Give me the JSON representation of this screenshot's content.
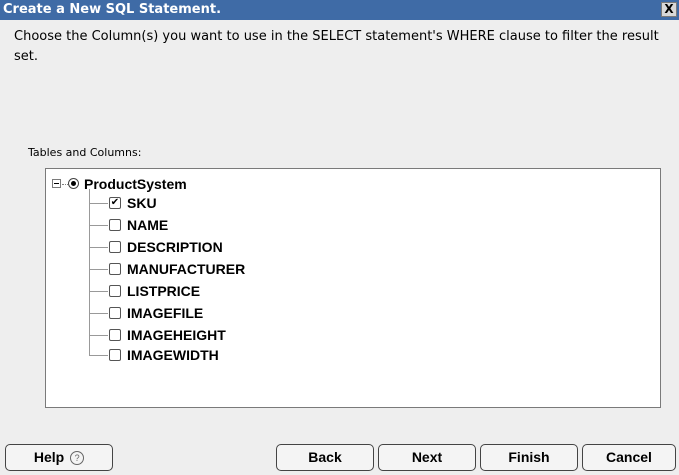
{
  "window": {
    "title": "Create a New SQL Statement.",
    "close_glyph": "X"
  },
  "instruction": "Choose the Column(s) you want to use in the SELECT statement's WHERE clause to filter the result set.",
  "tree": {
    "section_label": "Tables and Columns:",
    "root": {
      "label": "ProductSystem",
      "selected": true,
      "expanded": true
    },
    "columns": [
      {
        "label": "SKU",
        "checked": true,
        "check_glyph": "✔"
      },
      {
        "label": "NAME",
        "checked": false,
        "check_glyph": ""
      },
      {
        "label": "DESCRIPTION",
        "checked": false,
        "check_glyph": ""
      },
      {
        "label": "MANUFACTURER",
        "checked": false,
        "check_glyph": ""
      },
      {
        "label": "LISTPRICE",
        "checked": false,
        "check_glyph": ""
      },
      {
        "label": "IMAGEFILE",
        "checked": false,
        "check_glyph": ""
      },
      {
        "label": "IMAGEHEIGHT",
        "checked": false,
        "check_glyph": ""
      },
      {
        "label": "IMAGEWIDTH",
        "checked": false,
        "check_glyph": ""
      }
    ]
  },
  "buttons": {
    "help": "Help",
    "help_icon": "?",
    "back": "Back",
    "next": "Next",
    "finish": "Finish",
    "cancel": "Cancel"
  },
  "colors": {
    "titlebar": "#3f6ba6",
    "window_bg": "#eeeeee"
  }
}
